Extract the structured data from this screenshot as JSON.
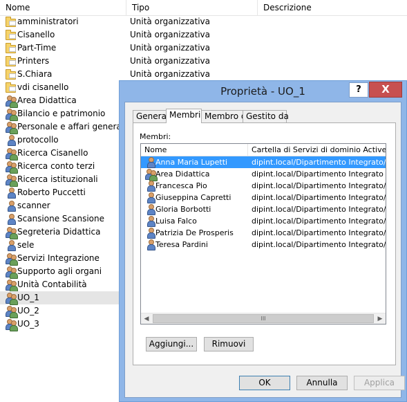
{
  "listview": {
    "columns": [
      "Nome",
      "Tipo",
      "Descrizione"
    ],
    "rows": [
      {
        "name": "amministratori",
        "type": "Unità organizzativa",
        "icon": "folder-icon"
      },
      {
        "name": "Cisanello",
        "type": "Unità organizzativa",
        "icon": "folder-icon"
      },
      {
        "name": "Part-Time",
        "type": "Unità organizzativa",
        "icon": "folder-icon"
      },
      {
        "name": "Printers",
        "type": "Unità organizzativa",
        "icon": "folder-icon"
      },
      {
        "name": "S.Chiara",
        "type": "Unità organizzativa",
        "icon": "folder-icon"
      },
      {
        "name": "vdi cisanello",
        "type": "Unità organizzativa",
        "icon": "folder-icon"
      },
      {
        "name": "Area Didattica",
        "type": "",
        "icon": "group-icon"
      },
      {
        "name": "Bilancio e patrimonio",
        "type": "",
        "icon": "group-icon"
      },
      {
        "name": "Personale e affari generali",
        "type": "",
        "icon": "group-icon"
      },
      {
        "name": "protocollo",
        "type": "",
        "icon": "user-icon"
      },
      {
        "name": "Ricerca Cisanello",
        "type": "",
        "icon": "group-icon"
      },
      {
        "name": "Ricerca conto terzi",
        "type": "",
        "icon": "group-icon"
      },
      {
        "name": "Ricerca istituzionali",
        "type": "",
        "icon": "group-icon"
      },
      {
        "name": "Roberto Puccetti",
        "type": "",
        "icon": "user-icon"
      },
      {
        "name": "scanner",
        "type": "",
        "icon": "user-icon"
      },
      {
        "name": "Scansione Scansione",
        "type": "",
        "icon": "user-icon"
      },
      {
        "name": "Segreteria Didattica",
        "type": "",
        "icon": "group-icon"
      },
      {
        "name": "sele",
        "type": "",
        "icon": "user-icon"
      },
      {
        "name": "Servizi Integrazione",
        "type": "",
        "icon": "group-icon"
      },
      {
        "name": "Supporto agli organi",
        "type": "",
        "icon": "group-icon"
      },
      {
        "name": "Unità Contabilità",
        "type": "",
        "icon": "group-icon"
      },
      {
        "name": "UO_1",
        "type": "",
        "icon": "group-icon",
        "selected": true
      },
      {
        "name": "UO_2",
        "type": "",
        "icon": "group-icon"
      },
      {
        "name": "UO_3",
        "type": "",
        "icon": "group-icon"
      }
    ]
  },
  "dialog": {
    "title": "Proprietà - UO_1",
    "help_label": "?",
    "close_label": "X",
    "tabs": [
      "Generale",
      "Membri",
      "Membro di",
      "Gestito da"
    ],
    "active_tab": "Membri",
    "members_label": "Membri:",
    "members_columns": [
      "Nome",
      "Cartella di Servizi di dominio Active Directory"
    ],
    "members": [
      {
        "name": "Anna Maria Lupetti",
        "path": "dipint.local/Dipartimento Integrato/S.Chiara",
        "icon": "user-icon",
        "selected": true
      },
      {
        "name": "Area Didattica",
        "path": "dipint.local/Dipartimento Integrato",
        "icon": "group-icon"
      },
      {
        "name": "Francesca Pio",
        "path": "dipint.local/Dipartimento Integrato/S.Chiara",
        "icon": "user-icon"
      },
      {
        "name": "Giuseppina Capretti",
        "path": "dipint.local/Dipartimento Integrato/S.Chiara",
        "icon": "user-icon"
      },
      {
        "name": "Gloria Borbotti",
        "path": "dipint.local/Dipartimento Integrato/S.Chiara",
        "icon": "user-icon"
      },
      {
        "name": "Luisa Falco",
        "path": "dipint.local/Dipartimento Integrato/S.Chiara",
        "icon": "user-icon"
      },
      {
        "name": "Patrizia De Prosperis",
        "path": "dipint.local/Dipartimento Integrato/S.Chiara",
        "icon": "user-icon"
      },
      {
        "name": "Teresa Pardini",
        "path": "dipint.local/Dipartimento Integrato/S.Chiara",
        "icon": "user-icon"
      }
    ],
    "scroll_left": "◀",
    "scroll_right": "▶",
    "scroll_grip": "III",
    "buttons": {
      "add": "Aggiungi...",
      "remove": "Rimuovi",
      "ok": "OK",
      "cancel": "Annulla",
      "apply": "Applica"
    }
  },
  "colors": {
    "selection": "#3399ff",
    "dialog_frame": "#8fb6e8",
    "close_button": "#c75050"
  }
}
